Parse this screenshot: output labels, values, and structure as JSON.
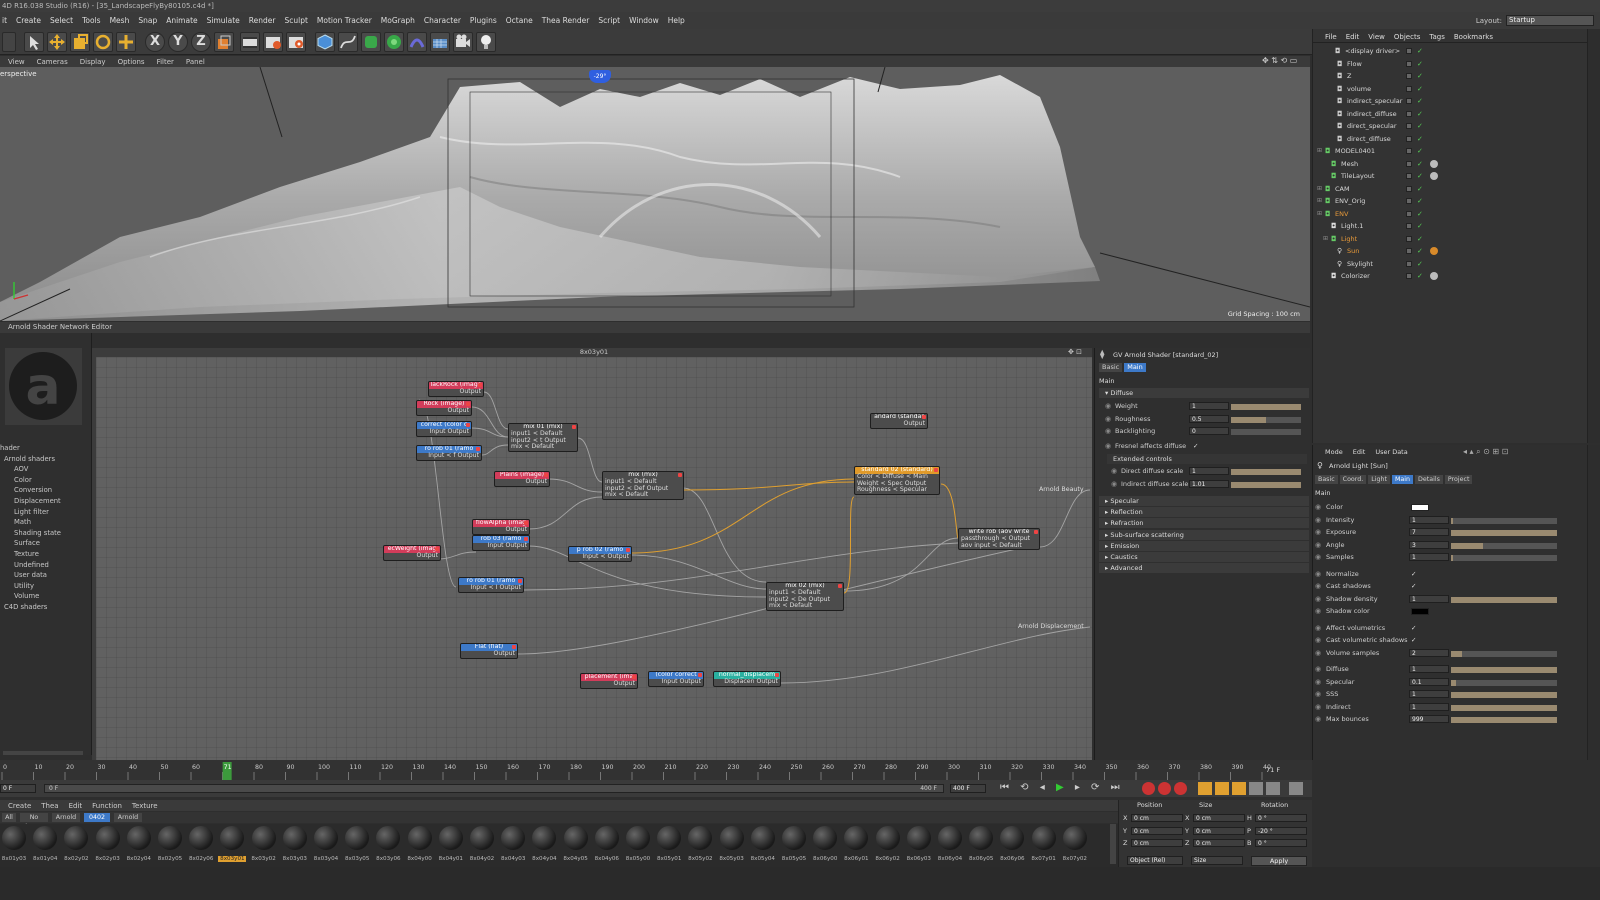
{
  "window": {
    "title": "4D R16.038 Studio (R16) - [35_LandscapeFlyBy80105.c4d *]"
  },
  "menubar": {
    "items": [
      "it",
      "Create",
      "Select",
      "Tools",
      "Mesh",
      "Snap",
      "Animate",
      "Simulate",
      "Render",
      "Sculpt",
      "Motion Tracker",
      "MoGraph",
      "Character",
      "Plugins",
      "Octane",
      "Thea Render",
      "Script",
      "Window",
      "Help"
    ]
  },
  "layout": {
    "label": "Layout:",
    "value": "Startup"
  },
  "toolbar": {
    "x_label": "X",
    "y_label": "Y",
    "z_label": "Z"
  },
  "viewport": {
    "menu": [
      "View",
      "Cameras",
      "Display",
      "Options",
      "Filter",
      "Panel"
    ],
    "name": "erspective",
    "camera_marker": "-29°",
    "grid_spacing": "Grid Spacing : 100 cm"
  },
  "objects": {
    "menu": [
      "File",
      "Edit",
      "View",
      "Objects",
      "Tags",
      "Bookmarks"
    ],
    "rows": [
      {
        "name": "<display driver>",
        "color": "#d8d8d8"
      },
      {
        "name": "Flow",
        "color": "#d8d8d8"
      },
      {
        "name": "Z",
        "color": "#d8d8d8"
      },
      {
        "name": "volume",
        "color": "#d8d8d8"
      },
      {
        "name": "indirect_specular",
        "color": "#d8d8d8"
      },
      {
        "name": "indirect_diffuse",
        "color": "#d8d8d8"
      },
      {
        "name": "direct_specular",
        "color": "#d8d8d8"
      },
      {
        "name": "direct_diffuse",
        "color": "#d8d8d8"
      },
      {
        "name": "MODEL0401",
        "color": "#d8d8d8"
      },
      {
        "name": "Mesh",
        "color": "#d8d8d8"
      },
      {
        "name": "TileLayout",
        "color": "#d8d8d8"
      },
      {
        "name": "CAM",
        "color": "#d8d8d8"
      },
      {
        "name": "ENV_Orig",
        "color": "#d8d8d8"
      },
      {
        "name": "ENV",
        "color": "#e89a3a"
      },
      {
        "name": "Light.1",
        "color": "#d8d8d8"
      },
      {
        "name": "Light",
        "color": "#e89a3a"
      },
      {
        "name": "Sun",
        "color": "#e89a3a"
      },
      {
        "name": "Skylight",
        "color": "#d8d8d8"
      },
      {
        "name": "Colorizer",
        "color": "#d8d8d8"
      }
    ]
  },
  "shader_editor": {
    "title": "Arnold Shader Network Editor",
    "canvas_title": "8x03y01",
    "tree": [
      "hader",
      "Arnold shaders",
      "AOV",
      "Color",
      "Conversion",
      "Displacement",
      "Light filter",
      "Math",
      "Shading state",
      "Surface",
      "Texture",
      "Undefined",
      "User data",
      "Utility",
      "Volume",
      "C4D shaders"
    ],
    "nodes": {
      "blackrock": {
        "title": "lackRock (image",
        "lines": [
          "Output"
        ]
      },
      "rock": {
        "title": "Rock (image)",
        "lines": [
          "Output"
        ]
      },
      "correct": {
        "title": "correct (color c",
        "lines": [
          "Input  Output"
        ]
      },
      "ramp01a": {
        "title": "ro rob 01 (ramo",
        "lines": [
          "Input < f Output"
        ]
      },
      "mix01": {
        "title": "mix 01 (mix)",
        "lines": [
          "input1 < Default",
          "input2 < t Output",
          "mix < Default"
        ]
      },
      "plains": {
        "title": "Plains (image)",
        "lines": [
          "Output"
        ]
      },
      "mixmain": {
        "title": "mix (mix)",
        "lines": [
          "input1 < Default",
          "input2 < Def Output",
          "mix < Default"
        ]
      },
      "standard02": {
        "title": "standard 02 (standard)",
        "lines": [
          "Color < Diffuse < Main",
          "Weight < Spec Output",
          "Roughness < Specular"
        ]
      },
      "standard": {
        "title": "andard (standar",
        "lines": [
          "Output"
        ]
      },
      "write": {
        "title": "write rob (aov write",
        "lines": [
          "passthrough < Output",
          "aov input < Default"
        ]
      },
      "flowalpha": {
        "title": "flowAlpha (imag",
        "lines": [
          "Output"
        ]
      },
      "ramp03": {
        "title": "rob 03 (ramo",
        "lines": [
          "Input  Output"
        ]
      },
      "weight": {
        "title": "ecWeight (imag",
        "lines": [
          "Output"
        ]
      },
      "ramp02": {
        "title": "p rob 02 (ramo",
        "lines": [
          "Input < Output"
        ]
      },
      "ramp01b": {
        "title": "ro rob 01 (ramo",
        "lines": [
          "Input < I Output"
        ]
      },
      "mix02": {
        "title": "mix 02 (mix)",
        "lines": [
          "input1 < Default",
          "input2 < De Output",
          "mix < Default"
        ]
      },
      "flat": {
        "title": "Flat (flat)",
        "lines": [
          "Output"
        ]
      },
      "displacement": {
        "title": "placement (ima",
        "lines": [
          "Output"
        ]
      },
      "colorcorrect": {
        "title": "(color correct",
        "lines": [
          "Input  Output"
        ]
      },
      "normaldisp": {
        "title": "normal_displacem",
        "lines": [
          "Displacen Output"
        ]
      }
    },
    "outputs": {
      "beauty": "Arnold Beauty",
      "displacement": "Arnold Displacement"
    }
  },
  "shader_attr": {
    "header": "GV Arnold Shader [standard_02]",
    "tabs": [
      "Basic",
      "Main"
    ],
    "section": "Main",
    "diffuse": "Diffuse",
    "params": [
      {
        "label": "Weight",
        "value": "1",
        "fill": 1.0
      },
      {
        "label": "Roughness",
        "value": "0.5",
        "fill": 0.5
      },
      {
        "label": "Backlighting",
        "value": "0",
        "fill": 0.0
      }
    ],
    "fresnel": "Fresnel affects diffuse",
    "extended": "Extended controls",
    "ext_params": [
      {
        "label": "Direct diffuse scale",
        "value": "1",
        "fill": 1.0
      },
      {
        "label": "Indirect diffuse scale",
        "value": "1.01",
        "fill": 1.0
      }
    ],
    "sections": [
      "Specular",
      "Reflection",
      "Refraction",
      "Sub-surface scattering",
      "Emission",
      "Caustics",
      "Advanced"
    ]
  },
  "light_attr": {
    "menu": [
      "Mode",
      "Edit",
      "User Data"
    ],
    "header": "Arnold Light [Sun]",
    "tabs": [
      "Basic",
      "Coord.",
      "Light",
      "Main",
      "Details",
      "Project"
    ],
    "section": "Main",
    "rows": [
      {
        "label": "Color",
        "value": "",
        "fill": 0,
        "kind": "color"
      },
      {
        "label": "Intensity",
        "value": "1",
        "fill": 0.02,
        "kind": "num"
      },
      {
        "label": "Exposure",
        "value": "7",
        "fill": 1.0,
        "kind": "num"
      },
      {
        "label": "Angle",
        "value": "3",
        "fill": 0.3,
        "kind": "num"
      },
      {
        "label": "Samples",
        "value": "1",
        "fill": 0.02,
        "kind": "num"
      },
      {
        "label": "Normalize",
        "value": "",
        "fill": 0,
        "kind": "check"
      },
      {
        "label": "Cast shadows",
        "value": "",
        "fill": 0,
        "kind": "check"
      },
      {
        "label": "Shadow density",
        "value": "1",
        "fill": 1.0,
        "kind": "num"
      },
      {
        "label": "Shadow color",
        "value": "",
        "fill": 0,
        "kind": "black"
      },
      {
        "label": "Affect volumetrics",
        "value": "",
        "fill": 0,
        "kind": "check"
      },
      {
        "label": "Cast volumetric shadows",
        "value": "",
        "fill": 0,
        "kind": "check"
      },
      {
        "label": "Volume samples",
        "value": "2",
        "fill": 0.1,
        "kind": "num"
      },
      {
        "label": "Diffuse",
        "value": "1",
        "fill": 1.0,
        "kind": "num"
      },
      {
        "label": "Specular",
        "value": "0.1",
        "fill": 0.05,
        "kind": "num"
      },
      {
        "label": "SSS",
        "value": "1",
        "fill": 1.0,
        "kind": "num"
      },
      {
        "label": "Indirect",
        "value": "1",
        "fill": 1.0,
        "kind": "num"
      },
      {
        "label": "Max bounces",
        "value": "999",
        "fill": 1.0,
        "kind": "num"
      }
    ]
  },
  "timeline": {
    "ticks": [
      "0",
      "10",
      "20",
      "30",
      "40",
      "50",
      "60",
      "70",
      "80",
      "90",
      "100",
      "110",
      "120",
      "130",
      "140",
      "150",
      "160",
      "170",
      "180",
      "190",
      "200",
      "210",
      "220",
      "230",
      "240",
      "250",
      "260",
      "270",
      "280",
      "290",
      "300",
      "310",
      "320",
      "330",
      "340",
      "350",
      "360",
      "370",
      "380",
      "390",
      "40"
    ],
    "current": "71",
    "end_frame": "71 F",
    "start_field": "0 F",
    "range_start": "0 F",
    "range_end": "400 F",
    "max_field": "400 F"
  },
  "materials": {
    "menu": [
      "Create",
      "Thea",
      "Edit",
      "Function",
      "Texture"
    ],
    "filters": [
      "All",
      "No Layer",
      "Arnold",
      "0402",
      "Arnold"
    ],
    "active_filter": "0402",
    "items": [
      "8x01y03",
      "8x01y04",
      "8x02y02",
      "8x02y03",
      "8x02y04",
      "8x02y05",
      "8x02y06",
      "8x03y01",
      "8x03y02",
      "8x03y03",
      "8x03y04",
      "8x03y05",
      "8x03y06",
      "8x04y00",
      "8x04y01",
      "8x04y02",
      "8x04y03",
      "8x04y04",
      "8x04y05",
      "8x04y06",
      "8x05y00",
      "8x05y01",
      "8x05y02",
      "8x05y03",
      "8x05y04",
      "8x05y05",
      "8x06y00",
      "8x06y01",
      "8x06y02",
      "8x06y03",
      "8x06y04",
      "8x06y05",
      "8x06y06",
      "8x07y01",
      "8x07y02"
    ],
    "selected": "8x03y01"
  },
  "coords": {
    "headers": [
      "Position",
      "Size",
      "Rotation"
    ],
    "rows": [
      {
        "a": "X",
        "av": "0 cm",
        "b": "X",
        "bv": "0 cm",
        "c": "H",
        "cv": "0 °"
      },
      {
        "a": "Y",
        "av": "0 cm",
        "b": "Y",
        "bv": "0 cm",
        "c": "P",
        "cv": "-20 °"
      },
      {
        "a": "Z",
        "av": "0 cm",
        "b": "Z",
        "bv": "0 cm",
        "c": "B",
        "cv": "0 °"
      }
    ],
    "mode": "Object (Rel)",
    "size_mode": "Size",
    "apply": "Apply"
  }
}
